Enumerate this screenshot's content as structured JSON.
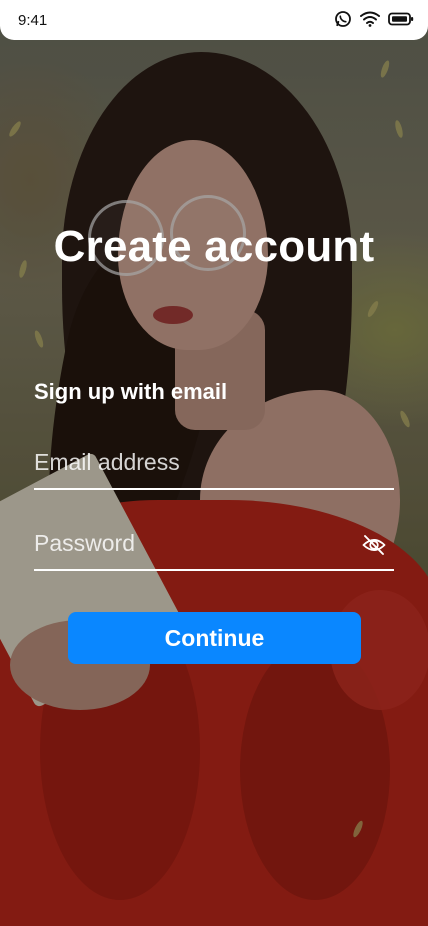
{
  "status_bar": {
    "time": "9:41",
    "icons": [
      "whatsapp-icon",
      "wifi-icon",
      "battery-icon"
    ]
  },
  "screen": {
    "title": "Create account",
    "subtitle": "Sign up with email"
  },
  "form": {
    "email": {
      "placeholder": "Email address",
      "value": ""
    },
    "password": {
      "placeholder": "Password",
      "value": "",
      "toggle_icon": "eye-off-icon"
    },
    "continue_label": "Continue"
  },
  "colors": {
    "accent": "#0a87ff",
    "text": "#ffffff"
  }
}
